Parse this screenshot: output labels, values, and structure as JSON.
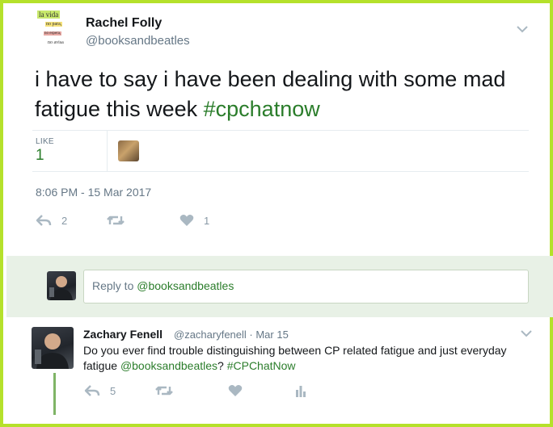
{
  "author": {
    "name": "Rachel Folly",
    "handle": "@booksandbeatles",
    "avatar_lines": [
      "la vida",
      "no para,",
      "no espera,",
      "no avisa"
    ]
  },
  "tweet": {
    "text": "i have to say i have been dealing with some mad fatigue this week ",
    "hashtag": "#cpchatnow",
    "likes_label": "LIKE",
    "likes_count": "1",
    "timestamp": "8:06 PM - 15 Mar 2017",
    "actions": {
      "reply_count": "2",
      "retweet_count": "",
      "like_count": "1"
    }
  },
  "reply_box": {
    "prefix": "Reply to ",
    "handle": "@booksandbeatles"
  },
  "reply_tweet": {
    "name": "Zachary Fenell",
    "meta": "@zacharyfenell · Mar 15",
    "text_part1": "Do you ever find trouble distinguishing between CP related fatigue and just everyday fatigue ",
    "mention": "@booksandbeatles",
    "text_part2": "? ",
    "hashtag": "#CPChatNow",
    "actions": {
      "reply_count": "5"
    }
  },
  "colors": {
    "frame": "#b5e12b",
    "accent": "#2b7d2b",
    "reply_bar_bg": "#e8f1e6",
    "muted": "#657786"
  }
}
